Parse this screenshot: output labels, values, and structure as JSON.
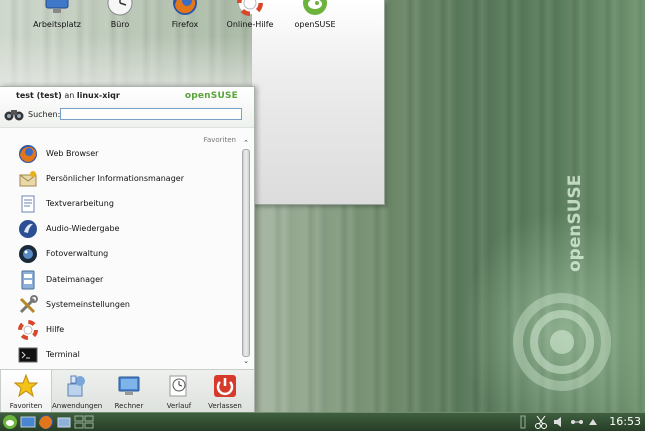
{
  "desktop_icons": [
    {
      "label": "Arbeitsplatz",
      "icon": "computer-icon"
    },
    {
      "label": "Büro",
      "icon": "clock-icon"
    },
    {
      "label": "Firefox",
      "icon": "firefox-icon"
    },
    {
      "label": "Online-Hilfe",
      "icon": "help-icon"
    },
    {
      "label": "openSUSE",
      "icon": "opensuse-icon"
    }
  ],
  "menu": {
    "user": {
      "name": "test (test)",
      "conj": " an ",
      "host": "linux-xiqr"
    },
    "brand": "openSUSE",
    "search": {
      "label": "Suchen:",
      "value": ""
    },
    "section_label": "Favoriten",
    "items": [
      {
        "label": "Web Browser",
        "icon": "firefox-icon"
      },
      {
        "label": "Persönlicher Informationsmanager",
        "icon": "pim-icon"
      },
      {
        "label": "Textverarbeitung",
        "icon": "wordprocessor-icon"
      },
      {
        "label": "Audio-Wiedergabe",
        "icon": "audio-player-icon"
      },
      {
        "label": "Fotoverwaltung",
        "icon": "photo-manager-icon"
      },
      {
        "label": "Dateimanager",
        "icon": "file-manager-icon"
      },
      {
        "label": "Systemeinstellungen",
        "icon": "system-settings-icon"
      },
      {
        "label": "Hilfe",
        "icon": "help-icon"
      },
      {
        "label": "Terminal",
        "icon": "terminal-icon"
      }
    ],
    "tabs": [
      {
        "label": "Favoriten",
        "icon": "star-icon",
        "active": true
      },
      {
        "label": "Anwendungen",
        "icon": "applications-icon",
        "active": false
      },
      {
        "label": "Rechner",
        "icon": "computer-icon",
        "active": false
      },
      {
        "label": "Verlauf",
        "icon": "history-icon",
        "active": false
      },
      {
        "label": "Verlassen",
        "icon": "power-icon",
        "active": false
      }
    ]
  },
  "taskbar": {
    "clock": "16:53"
  },
  "wallpaper": {
    "text": "openSUSE"
  },
  "colors": {
    "brand_green": "#5aa43a",
    "taskbar": "#2f4a2f",
    "power_red": "#d63a2a"
  }
}
